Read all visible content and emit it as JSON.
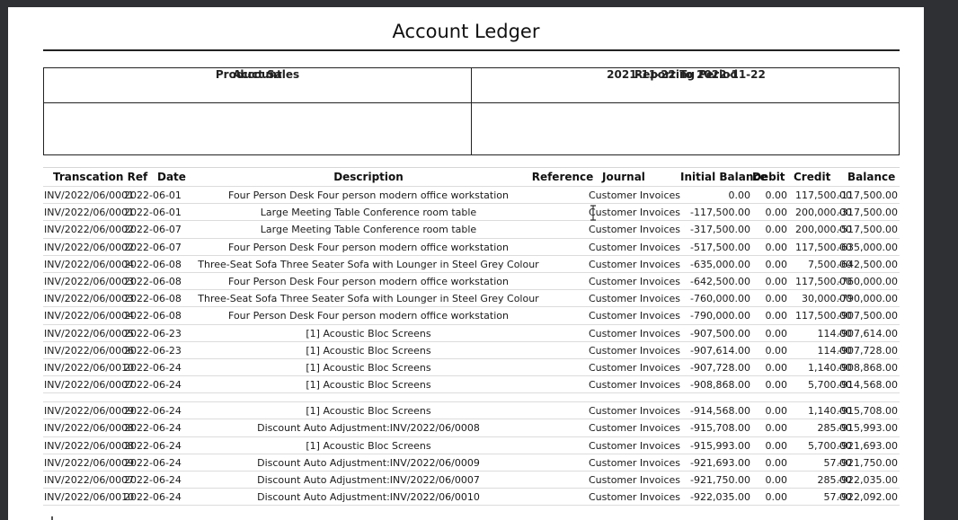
{
  "document": {
    "title": "Account Ledger"
  },
  "info_table": {
    "account_header": "Account",
    "period_header": "Reporting Period",
    "account_value": "Product Sales",
    "period_value": "2021-11-22 To 2022-11-22"
  },
  "ledger": {
    "columns": {
      "ref": "Transcation Ref",
      "date": "Date",
      "description": "Description",
      "reference": "Reference",
      "journal": "Journal",
      "initial_balance": "Initial Balance",
      "debit": "Debit",
      "credit": "Credit",
      "balance": "Balance"
    },
    "rows": [
      {
        "ref": "INV/2022/06/0001",
        "date": "2022-06-01",
        "description": "Four Person Desk Four person modern office workstation",
        "reference": "",
        "journal": "Customer Invoices",
        "initial_balance": "0.00",
        "debit": "0.00",
        "credit": "117,500.00",
        "balance": "-117,500.00"
      },
      {
        "ref": "INV/2022/06/0001",
        "date": "2022-06-01",
        "description": "Large Meeting Table Conference room table",
        "reference": "",
        "journal": "Customer Invoices",
        "initial_balance": "-117,500.00",
        "debit": "0.00",
        "credit": "200,000.00",
        "balance": "-317,500.00"
      },
      {
        "ref": "INV/2022/06/0002",
        "date": "2022-06-07",
        "description": "Large Meeting Table Conference room table",
        "reference": "",
        "journal": "Customer Invoices",
        "initial_balance": "-317,500.00",
        "debit": "0.00",
        "credit": "200,000.00",
        "balance": "-517,500.00"
      },
      {
        "ref": "INV/2022/06/0002",
        "date": "2022-06-07",
        "description": "Four Person Desk Four person modern office workstation",
        "reference": "",
        "journal": "Customer Invoices",
        "initial_balance": "-517,500.00",
        "debit": "0.00",
        "credit": "117,500.00",
        "balance": "-635,000.00"
      },
      {
        "ref": "INV/2022/06/0004",
        "date": "2022-06-08",
        "description": "Three-Seat Sofa Three Seater Sofa with Lounger in Steel Grey Colour",
        "reference": "",
        "journal": "Customer Invoices",
        "initial_balance": "-635,000.00",
        "debit": "0.00",
        "credit": "7,500.00",
        "balance": "-642,500.00"
      },
      {
        "ref": "INV/2022/06/0003",
        "date": "2022-06-08",
        "description": "Four Person Desk Four person modern office workstation",
        "reference": "",
        "journal": "Customer Invoices",
        "initial_balance": "-642,500.00",
        "debit": "0.00",
        "credit": "117,500.00",
        "balance": "-760,000.00"
      },
      {
        "ref": "INV/2022/06/0003",
        "date": "2022-06-08",
        "description": "Three-Seat Sofa Three Seater Sofa with Lounger in Steel Grey Colour",
        "reference": "",
        "journal": "Customer Invoices",
        "initial_balance": "-760,000.00",
        "debit": "0.00",
        "credit": "30,000.00",
        "balance": "-790,000.00"
      },
      {
        "ref": "INV/2022/06/0004",
        "date": "2022-06-08",
        "description": "Four Person Desk Four person modern office workstation",
        "reference": "",
        "journal": "Customer Invoices",
        "initial_balance": "-790,000.00",
        "debit": "0.00",
        "credit": "117,500.00",
        "balance": "-907,500.00"
      },
      {
        "ref": "INV/2022/06/0005",
        "date": "2022-06-23",
        "description": "[1] Acoustic Bloc Screens",
        "reference": "",
        "journal": "Customer Invoices",
        "initial_balance": "-907,500.00",
        "debit": "0.00",
        "credit": "114.00",
        "balance": "-907,614.00"
      },
      {
        "ref": "INV/2022/06/0006",
        "date": "2022-06-23",
        "description": "[1] Acoustic Bloc Screens",
        "reference": "",
        "journal": "Customer Invoices",
        "initial_balance": "-907,614.00",
        "debit": "0.00",
        "credit": "114.00",
        "balance": "-907,728.00"
      },
      {
        "ref": "INV/2022/06/0010",
        "date": "2022-06-24",
        "description": "[1] Acoustic Bloc Screens",
        "reference": "",
        "journal": "Customer Invoices",
        "initial_balance": "-907,728.00",
        "debit": "0.00",
        "credit": "1,140.00",
        "balance": "-908,868.00"
      },
      {
        "ref": "INV/2022/06/0007",
        "date": "2022-06-24",
        "description": "[1] Acoustic Bloc Screens",
        "reference": "",
        "journal": "Customer Invoices",
        "initial_balance": "-908,868.00",
        "debit": "0.00",
        "credit": "5,700.00",
        "balance": "-914,568.00"
      },
      {
        "ref": "INV/2022/06/0009",
        "date": "2022-06-24",
        "description": "[1] Acoustic Bloc Screens",
        "reference": "",
        "journal": "Customer Invoices",
        "initial_balance": "-914,568.00",
        "debit": "0.00",
        "credit": "1,140.00",
        "balance": "-915,708.00"
      },
      {
        "ref": "INV/2022/06/0008",
        "date": "2022-06-24",
        "description": "Discount Auto Adjustment:INV/2022/06/0008",
        "reference": "",
        "journal": "Customer Invoices",
        "initial_balance": "-915,708.00",
        "debit": "0.00",
        "credit": "285.00",
        "balance": "-915,993.00"
      },
      {
        "ref": "INV/2022/06/0008",
        "date": "2022-06-24",
        "description": "[1] Acoustic Bloc Screens",
        "reference": "",
        "journal": "Customer Invoices",
        "initial_balance": "-915,993.00",
        "debit": "0.00",
        "credit": "5,700.00",
        "balance": "-921,693.00"
      },
      {
        "ref": "INV/2022/06/0009",
        "date": "2022-06-24",
        "description": "Discount Auto Adjustment:INV/2022/06/0009",
        "reference": "",
        "journal": "Customer Invoices",
        "initial_balance": "-921,693.00",
        "debit": "0.00",
        "credit": "57.00",
        "balance": "-921,750.00"
      },
      {
        "ref": "INV/2022/06/0007",
        "date": "2022-06-24",
        "description": "Discount Auto Adjustment:INV/2022/06/0007",
        "reference": "",
        "journal": "Customer Invoices",
        "initial_balance": "-921,750.00",
        "debit": "0.00",
        "credit": "285.00",
        "balance": "-922,035.00"
      },
      {
        "ref": "INV/2022/06/0010",
        "date": "2022-06-24",
        "description": "Discount Auto Adjustment:INV/2022/06/0010",
        "reference": "",
        "journal": "Customer Invoices",
        "initial_balance": "-922,035.00",
        "debit": "0.00",
        "credit": "57.00",
        "balance": "-922,092.00"
      }
    ]
  },
  "icons": {
    "cursor": "text-cursor-icon"
  }
}
